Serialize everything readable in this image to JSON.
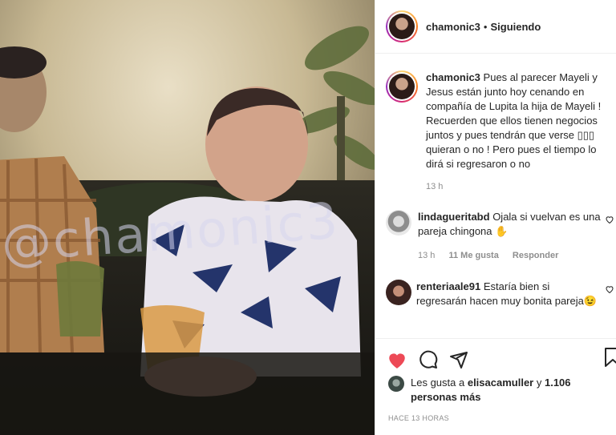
{
  "post": {
    "username": "chamonic3",
    "separator": "•",
    "follow_status": "Siguiendo",
    "watermark": "@chamonic3"
  },
  "caption": {
    "username": "chamonic3",
    "text": "Pues al parecer Mayeli y Jesus están junto hoy cenando en compañía de Lupita la hija de Mayeli ! Recuerden que ellos tienen negocios juntos y pues tendrán que verse ▯▯▯ quieran o no ! Pero pues el tiempo lo dirá si regresaron o no",
    "time": "13 h"
  },
  "comments": [
    {
      "username": "lindagueritabd",
      "text": "Ojala si vuelvan es una pareja chingona ✋",
      "time": "13 h",
      "likes": "11 Me gusta",
      "reply": "Responder"
    },
    {
      "username": "renteriaale91",
      "text": "Estaría bien si regresarán hacen muy bonita pareja😉"
    }
  ],
  "likes": {
    "prefix": "Les gusta a",
    "user": "elisacamuller",
    "conj": "y",
    "others": "1.106 personas más"
  },
  "timestamp": "HACE 13 HORAS",
  "icons": [
    "heart-filled-icon",
    "comment-icon",
    "share-icon",
    "bookmark-icon",
    "heart-outline-icon"
  ],
  "colors": {
    "like": "#ed4956",
    "text": "#262626",
    "secondary": "#8e8e8e",
    "border": "#efefef"
  }
}
